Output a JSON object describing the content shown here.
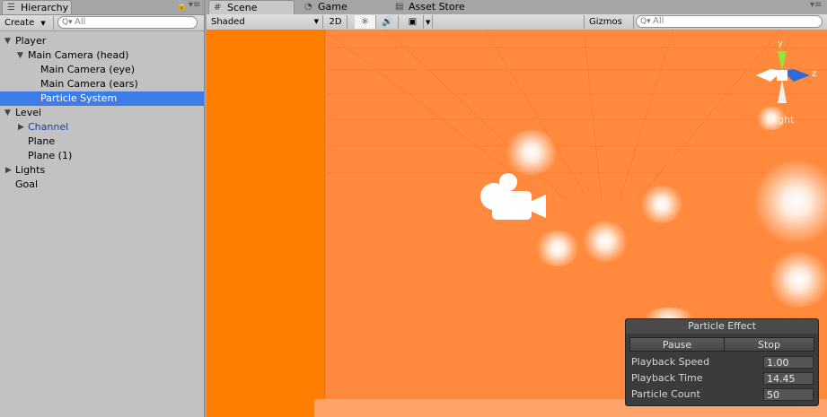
{
  "hierarchy": {
    "tab_label": "Hierarchy",
    "create_label": "Create",
    "search_placeholder": "All",
    "items": [
      {
        "label": "Player",
        "expanded": true
      },
      {
        "label": "Main Camera (head)",
        "expanded": true
      },
      {
        "label": "Main Camera (eye)"
      },
      {
        "label": "Main Camera (ears)"
      },
      {
        "label": "Particle System",
        "selected": true
      },
      {
        "label": "Level",
        "expanded": true
      },
      {
        "label": "Channel",
        "expanded": false
      },
      {
        "label": "Plane"
      },
      {
        "label": "Plane (1)"
      },
      {
        "label": "Lights",
        "expanded": false
      },
      {
        "label": "Goal"
      }
    ]
  },
  "tabs": {
    "scene": "Scene",
    "game": "Game",
    "asset_store": "Asset Store"
  },
  "scene_toolbar": {
    "shading_mode": "Shaded",
    "mode_2d": "2D",
    "gizmos_label": "Gizmos",
    "search_placeholder": "All"
  },
  "viewport": {
    "background_color": "#ff8a3d",
    "wall_color": "#ff7e00",
    "light_label": "Light",
    "axis_y": "y",
    "axis_z": "z"
  },
  "particle_effect": {
    "title": "Particle Effect",
    "pause_label": "Pause",
    "stop_label": "Stop",
    "playback_speed_label": "Playback Speed",
    "playback_speed": "1.00",
    "playback_time_label": "Playback Time",
    "playback_time": "14.45",
    "particle_count_label": "Particle Count",
    "particle_count": "50"
  }
}
